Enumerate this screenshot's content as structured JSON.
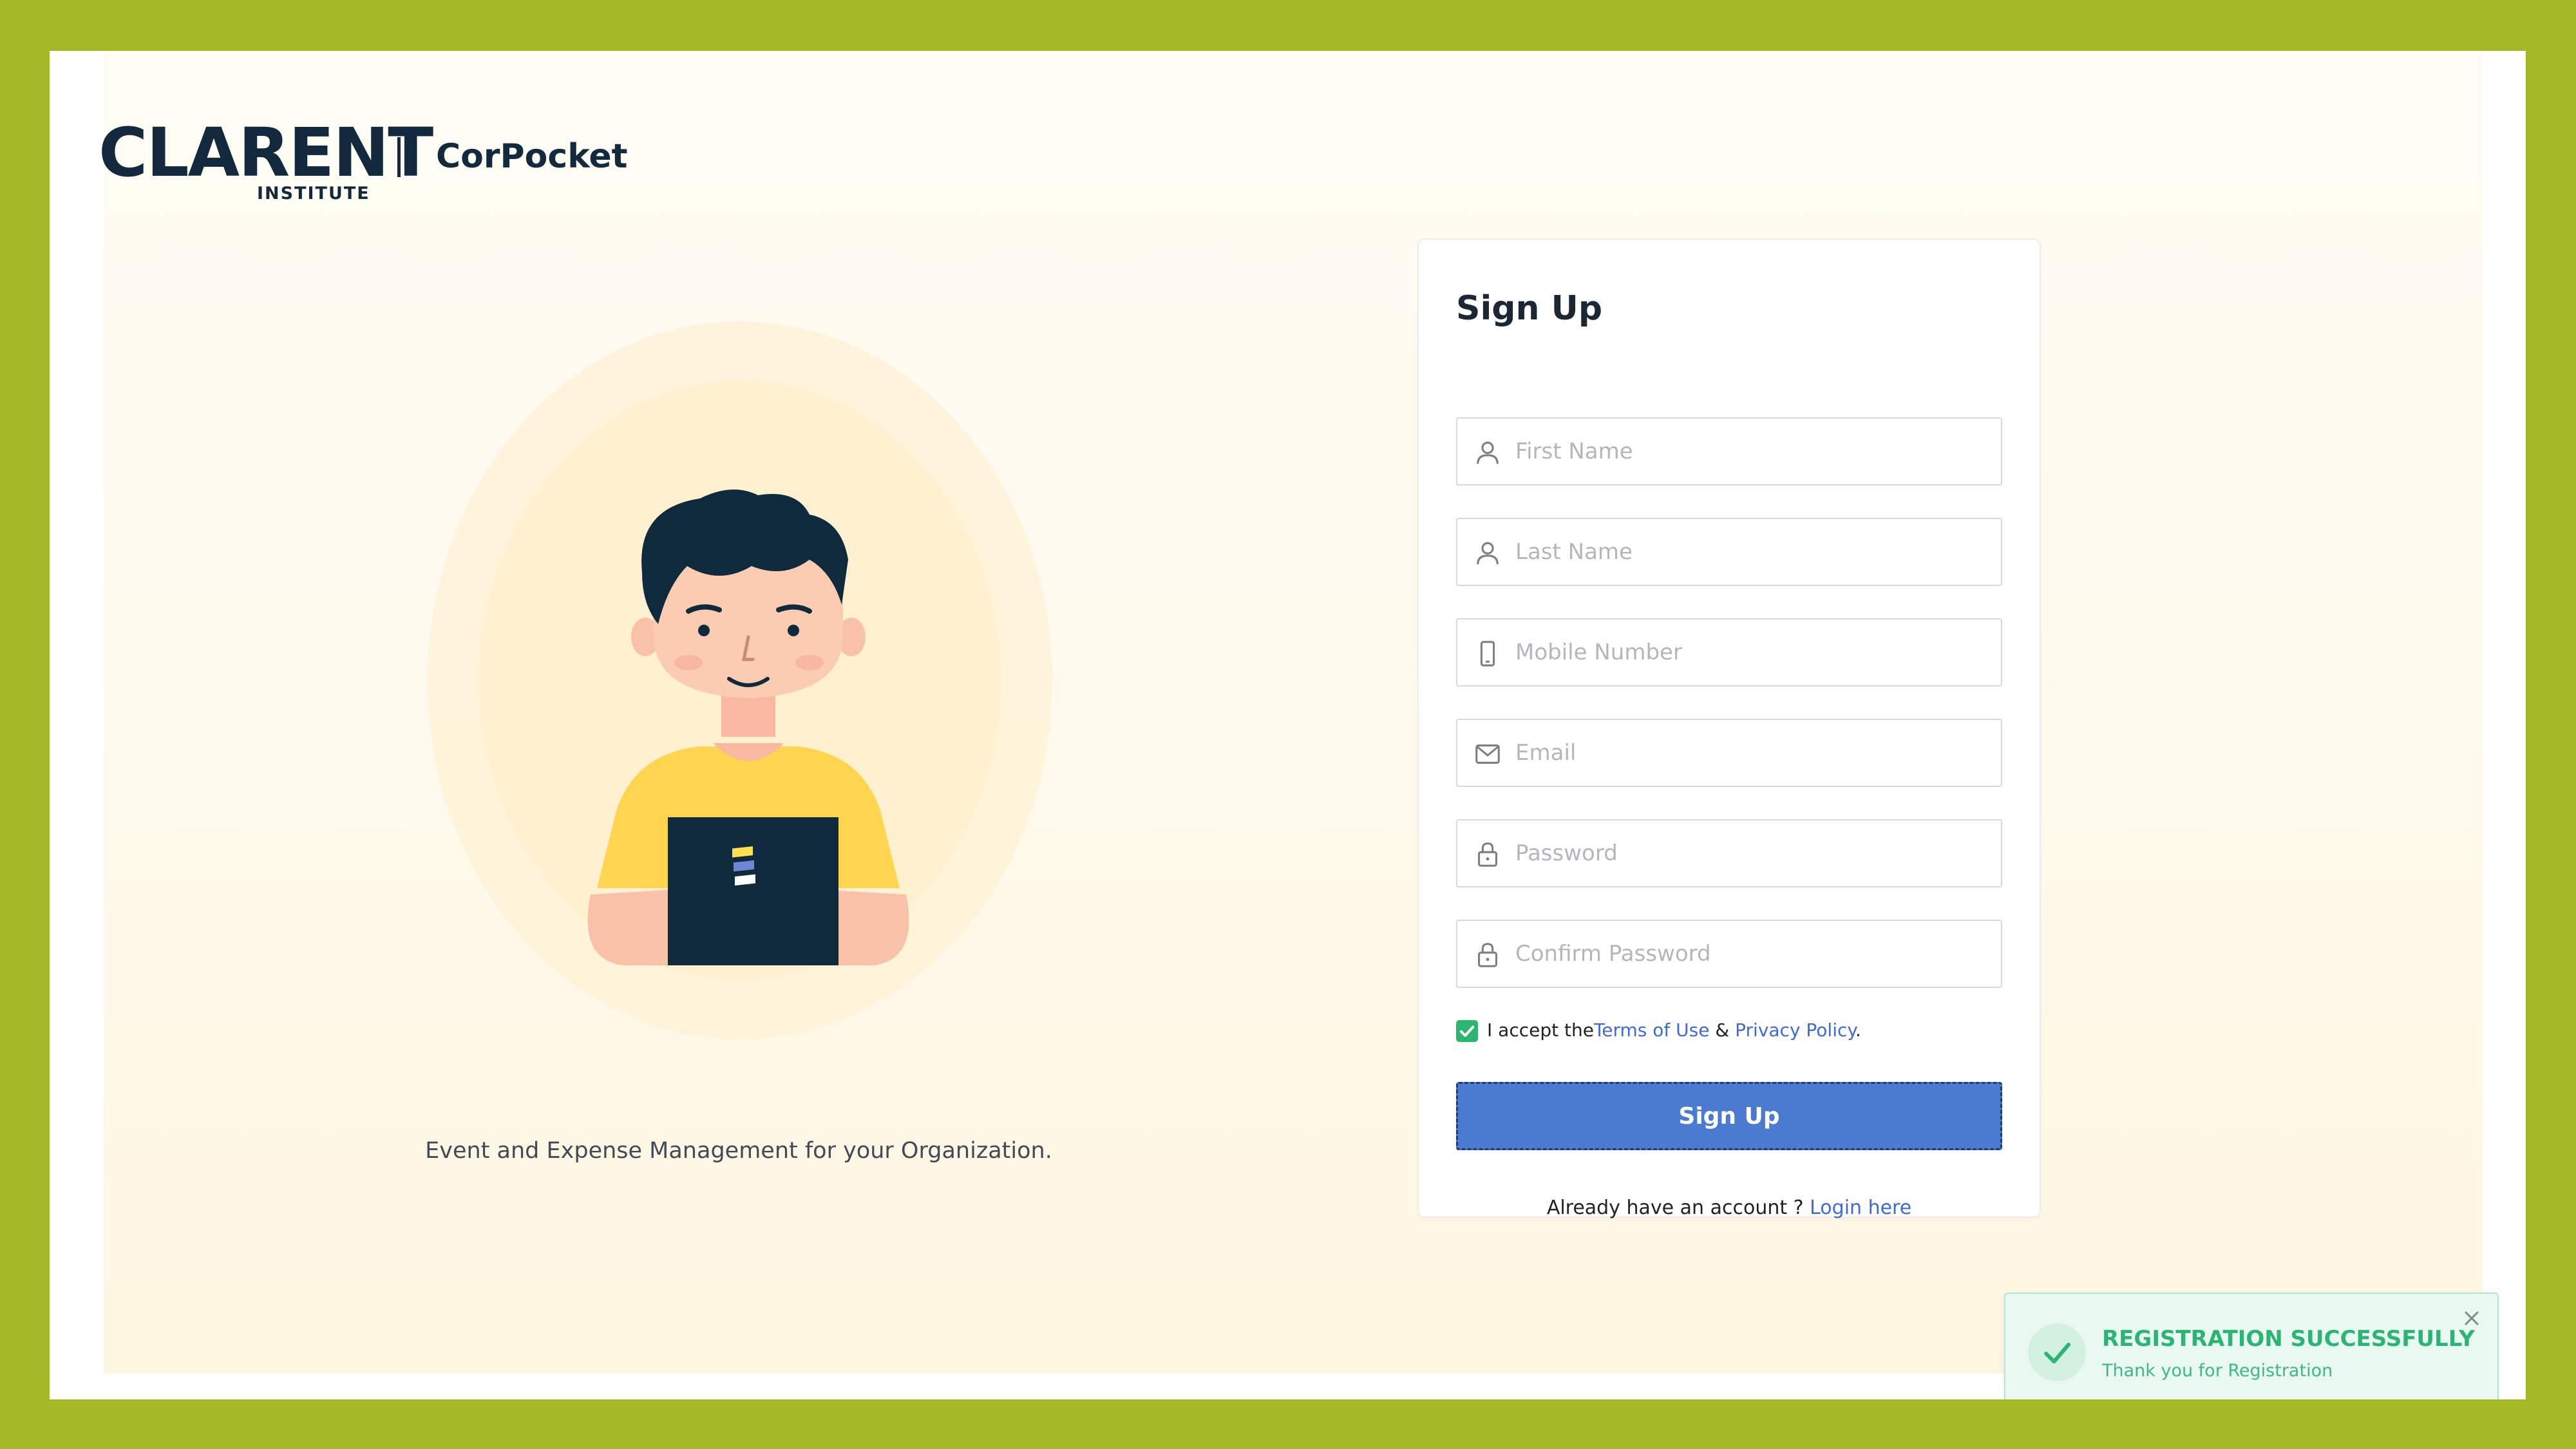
{
  "brand": {
    "logo_text": "CLARENT",
    "logo_subtext": "INSTITUTE",
    "product_name": "CorPocket"
  },
  "hero": {
    "tagline": "Event and Expense Management for your Organization."
  },
  "signup_form": {
    "title": "Sign Up",
    "fields": [
      {
        "placeholder": "First Name",
        "icon": "user-icon",
        "value": ""
      },
      {
        "placeholder": "Last Name",
        "icon": "user-icon",
        "value": ""
      },
      {
        "placeholder": "Mobile Number",
        "icon": "mobile-icon",
        "value": ""
      },
      {
        "placeholder": "Email",
        "icon": "mail-icon",
        "value": ""
      },
      {
        "placeholder": "Password",
        "icon": "lock-icon",
        "value": ""
      },
      {
        "placeholder": "Confirm Password",
        "icon": "lock-icon",
        "value": ""
      }
    ],
    "terms": {
      "checked": true,
      "prefix": "I accept the",
      "terms_link": "Terms of Use",
      "and": " & ",
      "privacy_link": "Privacy Policy",
      "suffix": "."
    },
    "submit_label": "Sign Up",
    "login_prompt": "Already have an account ? ",
    "login_link": "Login here"
  },
  "toast": {
    "title": "REGISTRATION SUCCESSFULLY",
    "message": "Thank you for Registration",
    "icon": "check-icon"
  },
  "colors": {
    "outer_border": "#a4b927",
    "primary": "#4a7bd0",
    "success": "#2bb574",
    "brand_navy": "#13293d",
    "shirt": "#ffd54f"
  }
}
